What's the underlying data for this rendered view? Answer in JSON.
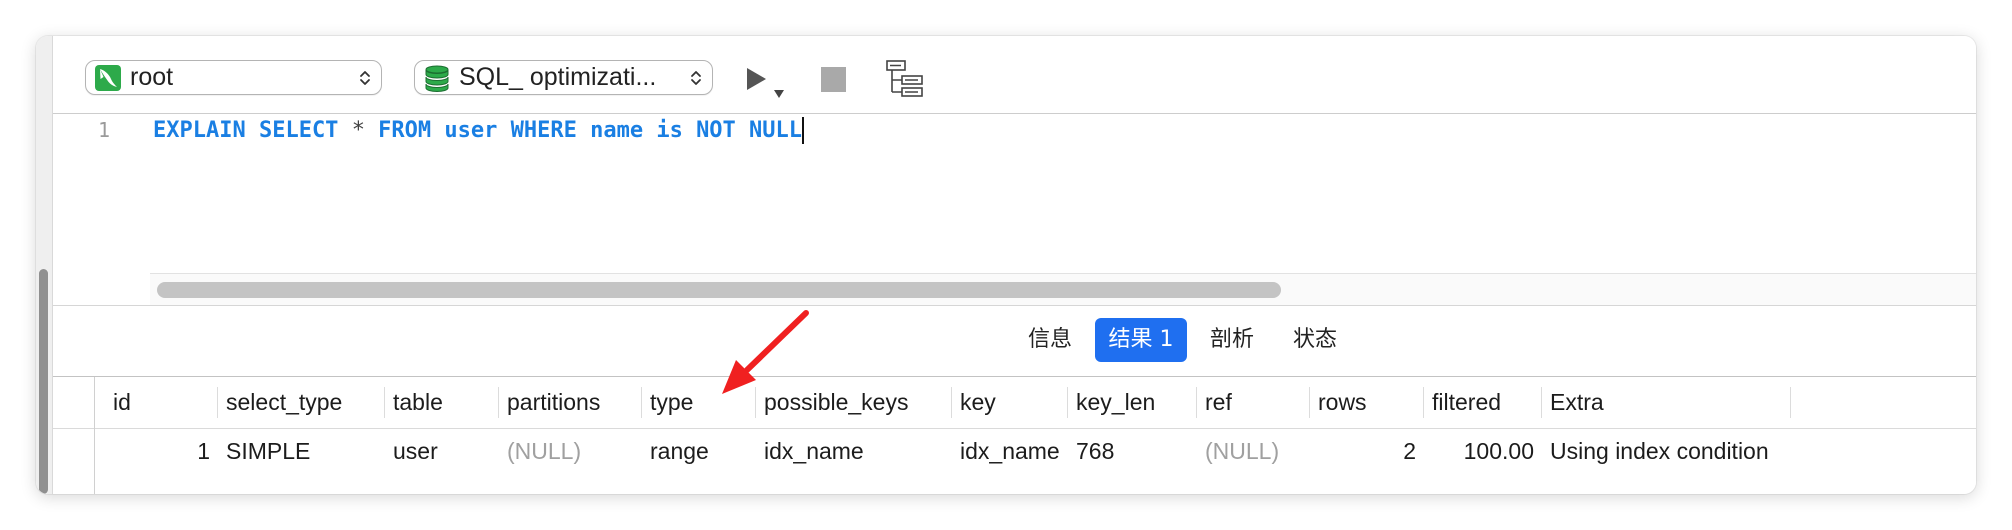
{
  "toolbar": {
    "connection_select": {
      "label": "root",
      "icon": "mysql-connection-icon"
    },
    "database_select": {
      "label": "SQL_ optimizati...",
      "icon": "database-icon"
    },
    "run_button": {
      "icon": "play-icon",
      "menu_icon": "dropdown-triangle-icon"
    },
    "stop_button": {
      "icon": "stop-icon"
    },
    "explain_button": {
      "icon": "explain-tree-icon"
    }
  },
  "editor": {
    "lines": [
      {
        "number": "1",
        "tokens": [
          "EXPLAIN SELECT ",
          "*",
          " FROM user WHERE name is NOT NULL"
        ]
      }
    ]
  },
  "results": {
    "tabs": [
      {
        "label": "信息",
        "selected": false
      },
      {
        "label": "结果 1",
        "selected": true
      },
      {
        "label": "剖析",
        "selected": false
      },
      {
        "label": "状态",
        "selected": false
      }
    ],
    "columns": [
      "id",
      "select_type",
      "table",
      "partitions",
      "type",
      "possible_keys",
      "key",
      "key_len",
      "ref",
      "rows",
      "filtered",
      "Extra"
    ],
    "rows": [
      [
        "1",
        "SIMPLE",
        "user",
        "(NULL)",
        "range",
        "idx_name",
        "idx_name",
        "768",
        "(NULL)",
        "2",
        "100.00",
        "Using index condition"
      ]
    ]
  },
  "annotation": {
    "icon": "red-arrow-icon"
  },
  "colors": {
    "accent": "#1f6ff0",
    "sql_keyword": "#1a7fe3",
    "sql_operator": "#444444",
    "null_value": "#a0a0a0",
    "mysql_green": "#2daa4a",
    "annotation_red": "#f02020"
  }
}
